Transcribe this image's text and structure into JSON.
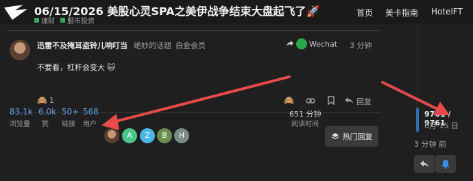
{
  "header": {
    "title": "06/15/2026 美股心灵SPA之美伊战争结束大盘起飞了🚀",
    "tags": [
      {
        "label": "理财",
        "color": "#3aa55d"
      },
      {
        "label": "股市投资",
        "color": "#3aa55d"
      }
    ],
    "nav": [
      "首页",
      "美卡指南",
      "HotelFT"
    ]
  },
  "post": {
    "author": "迅雷不及掩耳盗铃儿响叮当",
    "author_title": "绝妙的话题",
    "author_badge": "白金会员",
    "share_label": "Wechat",
    "time": "3 分钟",
    "body": "不要看，杠杆会变大 🐱",
    "reaction_count": "1",
    "reply_label": "回复"
  },
  "stats": {
    "items": [
      {
        "value": "83.1k",
        "label": "浏览量"
      },
      {
        "value": "6.0k",
        "label": "赞"
      },
      {
        "value": "50+",
        "label": "链接"
      },
      {
        "value": "568",
        "label": "用户"
      }
    ],
    "participants": [
      {
        "letter": "",
        "color": ""
      },
      {
        "letter": "A",
        "color": "#4cc48a"
      },
      {
        "letter": "Z",
        "color": "#49b6e6"
      },
      {
        "letter": "B",
        "color": "#6b8e4e"
      },
      {
        "letter": "H",
        "color": "#7d8b86"
      }
    ],
    "read_time": "651 分钟",
    "read_label": "阅读时间",
    "hot_button": "热门回复"
  },
  "timeline": {
    "count": "9761 / 9761",
    "date": "6月 15 日",
    "ago": "3 分钟 前"
  },
  "colors": {
    "accent": "#2f6fb5",
    "arrow": "#e84a4a",
    "stat_blue": "#5aa0e0"
  }
}
